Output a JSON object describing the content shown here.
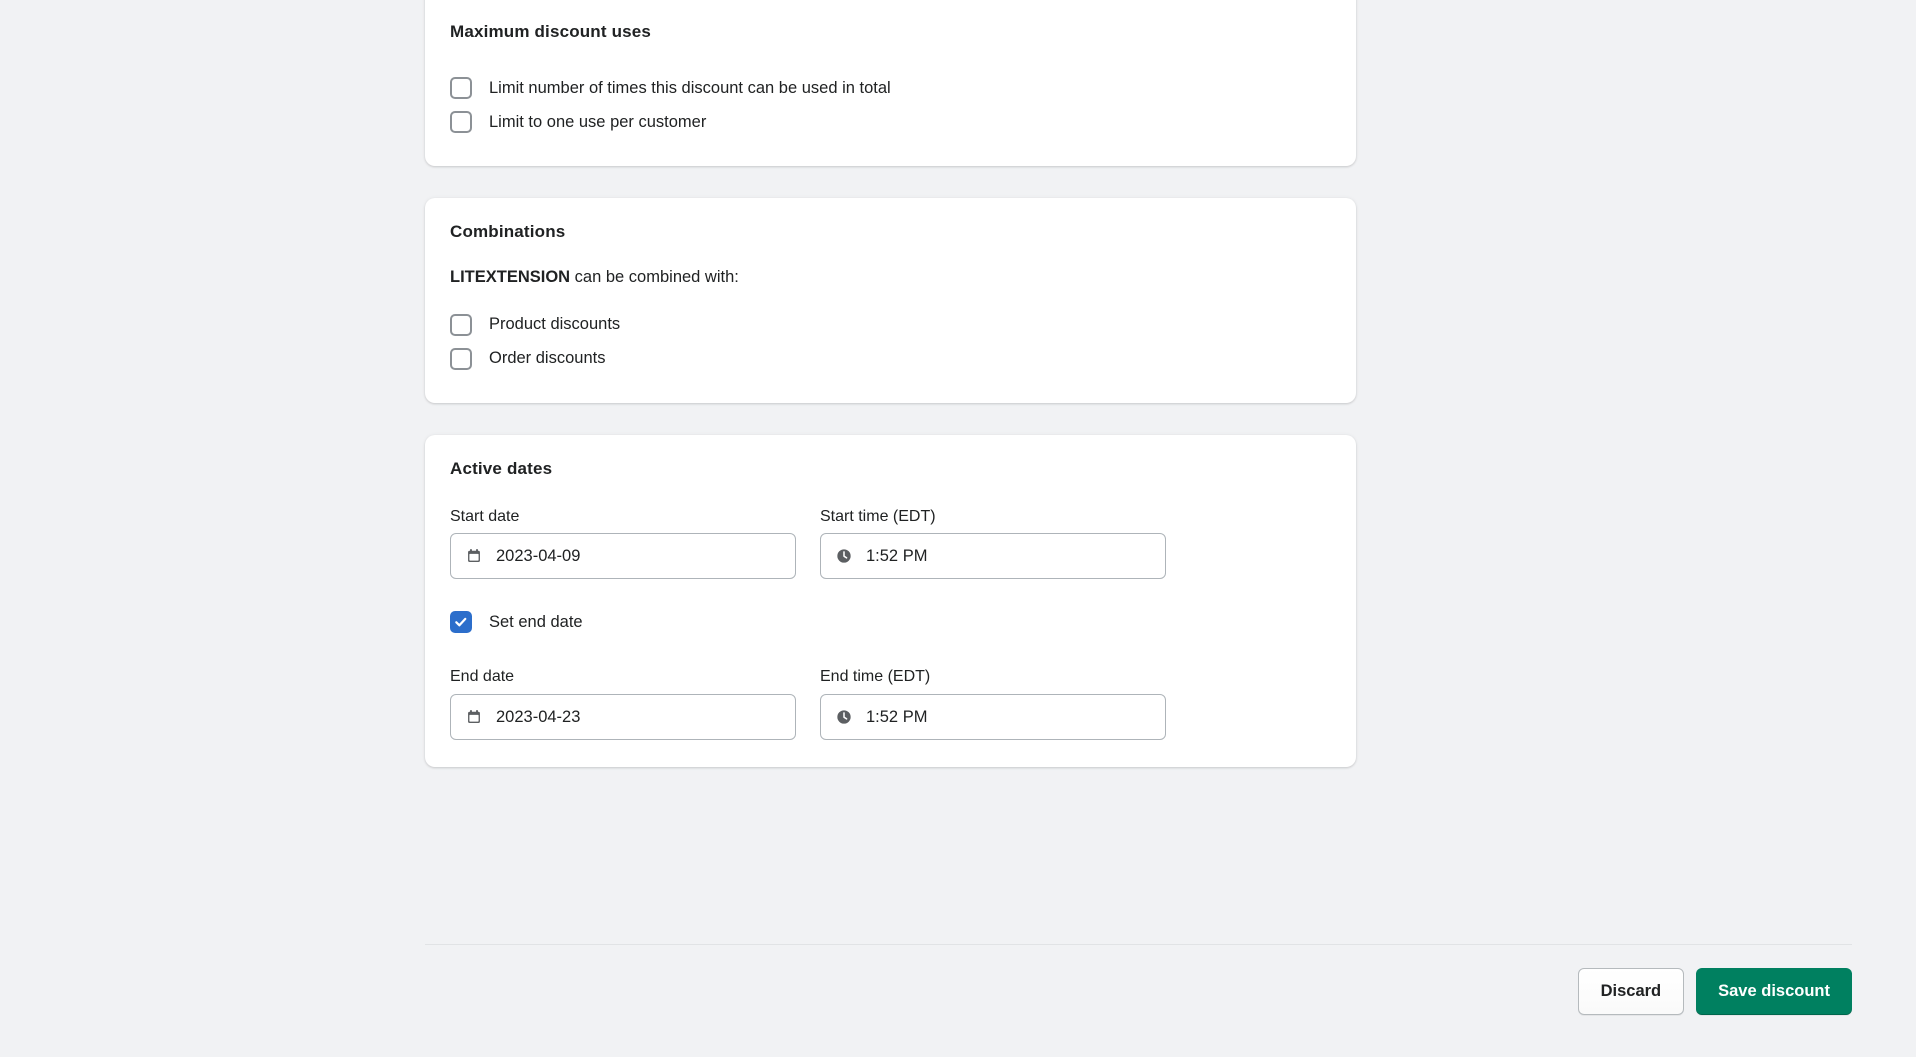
{
  "cards": {
    "max_uses": {
      "title": "Maximum discount uses",
      "options": [
        {
          "label": "Limit number of times this discount can be used in total",
          "checked": false
        },
        {
          "label": "Limit to one use per customer",
          "checked": false
        }
      ]
    },
    "combinations": {
      "title": "Combinations",
      "discount_code": "LITEXTENSION",
      "combine_suffix": " can be combined with:",
      "options": [
        {
          "label": "Product discounts",
          "checked": false
        },
        {
          "label": "Order discounts",
          "checked": false
        }
      ]
    },
    "active_dates": {
      "title": "Active dates",
      "start_date_label": "Start date",
      "start_date_value": "2023-04-09",
      "start_time_label": "Start time (EDT)",
      "start_time_value": "1:52 PM",
      "set_end_date_label": "Set end date",
      "set_end_date_checked": true,
      "end_date_label": "End date",
      "end_date_value": "2023-04-23",
      "end_time_label": "End time (EDT)",
      "end_time_value": "1:52 PM"
    }
  },
  "footer": {
    "discard_label": "Discard",
    "save_label": "Save discount"
  },
  "colors": {
    "page_background": "#f1f2f4",
    "card_background": "#ffffff",
    "text_primary": "#202223",
    "checkbox_checked": "#2c6ecb",
    "primary_button": "#008060",
    "divider": "#e1e3e5",
    "icon_gray": "#5c5f62"
  }
}
